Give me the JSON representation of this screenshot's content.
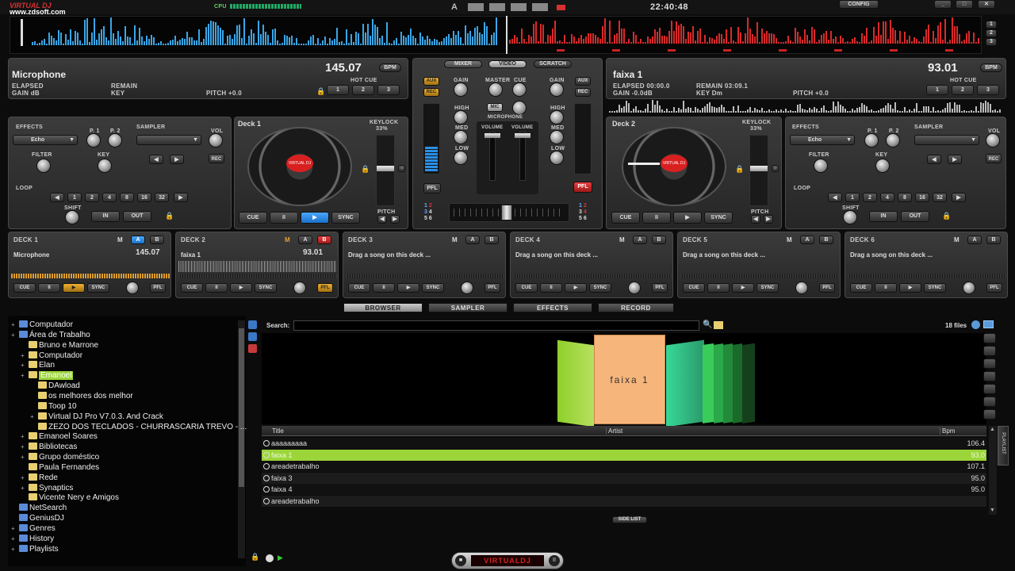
{
  "app": {
    "logo": "VIRTUAL DJ",
    "watermark": "www.zdsoft.com",
    "clock": "22:40:48",
    "cpu_label": "CPU",
    "config_label": "CONFIG",
    "layout_buttons": [
      "1",
      "2",
      "3"
    ],
    "a_label": "A"
  },
  "deckA": {
    "title": "Microphone",
    "bpm": "145.07",
    "bpm_unit": "BPM",
    "elapsed": "ELAPSED",
    "remain": "REMAIN",
    "gain": "GAIN dB",
    "key": "KEY",
    "pitch": "PITCH +0.0",
    "hotcue": "HOT CUE",
    "hotcues": [
      "1",
      "2",
      "3"
    ],
    "effects": "EFFECTS",
    "effect_value": "Echo",
    "p1": "P. 1",
    "p2": "P. 2",
    "filter": "FILTER",
    "key2": "KEY",
    "sampler": "SAMPLER",
    "vol": "VOL",
    "rec": "REC",
    "loop": "LOOP",
    "loop_values": [
      "1",
      "2",
      "4",
      "8",
      "16",
      "32"
    ],
    "shift": "SHIFT",
    "in": "IN",
    "out": "OUT",
    "deck_label": "Deck 1",
    "keylock": "KEYLOCK",
    "keylock_pct": "33%",
    "pitch_lbl": "PITCH",
    "cue": "CUE",
    "pause": "II",
    "play": "▶",
    "sync": "SYNC",
    "platter_logo": "VIRTUAL DJ"
  },
  "deckB": {
    "title": "faixa 1",
    "bpm": "93.01",
    "bpm_unit": "BPM",
    "elapsed": "ELAPSED 00:00.0",
    "remain": "REMAIN 03:09.1",
    "gain": "GAIN -0.0dB",
    "key": "KEY Dm",
    "pitch": "PITCH +0.0",
    "hotcue": "HOT CUE",
    "hotcues": [
      "1",
      "2",
      "3"
    ],
    "effects": "EFFECTS",
    "effect_value": "Echo",
    "p1": "P. 1",
    "p2": "P. 2",
    "filter": "FILTER",
    "key2": "KEY",
    "sampler": "SAMPLER",
    "vol": "VOL",
    "rec": "REC",
    "loop": "LOOP",
    "loop_values": [
      "1",
      "2",
      "4",
      "8",
      "16",
      "32"
    ],
    "shift": "SHIFT",
    "in": "IN",
    "out": "OUT",
    "deck_label": "Deck 2",
    "keylock": "KEYLOCK",
    "keylock_pct": "33%",
    "pitch_lbl": "PITCH",
    "cue": "CUE",
    "pause": "II",
    "play": "▶",
    "sync": "SYNC",
    "platter_logo": "VIRTUAL DJ"
  },
  "mixer": {
    "tabs": [
      "MIXER",
      "VIDEO",
      "SCRATCH"
    ],
    "aux": "AUX",
    "rec": "REC",
    "gain": "GAIN",
    "master": "MASTER",
    "cue": "CUE",
    "high": "HIGH",
    "med": "MED",
    "low": "LOW",
    "mic": "MIC",
    "microphone": "MICROPHONE",
    "volume": "VOLUME",
    "pfl": "PFL",
    "nums": [
      "1",
      "2",
      "3",
      "4",
      "5",
      "6"
    ]
  },
  "minidecks": [
    {
      "name": "DECK 1",
      "m": "M",
      "a": "A",
      "b": "B",
      "title": "Microphone",
      "bpm": "145.07"
    },
    {
      "name": "DECK 2",
      "m": "M",
      "a": "A",
      "b": "B",
      "title": "faixa 1",
      "bpm": "93.01"
    },
    {
      "name": "DECK 3",
      "m": "M",
      "a": "A",
      "b": "B",
      "title": "Drag a song on this deck ...",
      "bpm": ""
    },
    {
      "name": "DECK 4",
      "m": "M",
      "a": "A",
      "b": "B",
      "title": "Drag a song on this deck ...",
      "bpm": ""
    },
    {
      "name": "DECK 5",
      "m": "M",
      "a": "A",
      "b": "B",
      "title": "Drag a song on this deck ...",
      "bpm": ""
    },
    {
      "name": "DECK 6",
      "m": "M",
      "a": "A",
      "b": "B",
      "title": "Drag a song on this deck ...",
      "bpm": ""
    }
  ],
  "minideck_controls": {
    "cue": "CUE",
    "pause": "II",
    "play": "▶",
    "sync": "SYNC",
    "pfl": "PFL"
  },
  "tabs": [
    "BROWSER",
    "SAMPLER",
    "EFFECTS",
    "RECORD"
  ],
  "tree": [
    "Computador",
    "Área de Trabalho",
    "Bruno e Marrone",
    "Computador",
    "Elan",
    "Emanoel",
    "DAwload",
    "os melhores dos melhor",
    "Toop 10",
    "Virtual DJ Pro V7.0.3. And Crack",
    "ZEZO DOS TECLADOS  - CHURRASCARIA TREVO - ...",
    "Emanoel Soares",
    "Bibliotecas",
    "Grupo doméstico",
    "Paula Fernandes",
    "Rede",
    "Synaptics",
    "Vicente Nery e Amigos",
    "NetSearch",
    "GeniusDJ",
    "Genres",
    "History",
    "Playlists"
  ],
  "search": {
    "label": "Search:",
    "value": "",
    "count": "18 files"
  },
  "coverflow": {
    "center": "faixa 1"
  },
  "table": {
    "headers": [
      "Title",
      "Artist",
      "Bpm"
    ],
    "rows": [
      [
        "aaaaaaaaa",
        "",
        "106.4"
      ],
      [
        "faixa 1",
        "",
        "93.0"
      ],
      [
        "areadetrabalho",
        "",
        "107.1"
      ],
      [
        "faixa 3",
        "",
        "95.0"
      ],
      [
        "faixa 4",
        "",
        "95.0"
      ],
      [
        "areadetrabalho",
        "",
        ""
      ]
    ]
  },
  "side_list": "SIDE LIST",
  "playlist_tab": "PLAYLIST",
  "bottom_player": "VIRTUALDJ",
  "colors": {
    "accent_blue": "#2a8fe6",
    "wave_blue": "#3aa6e8",
    "wave_red": "#d82a2a",
    "row_select": "#9cd53a",
    "rec_red": "#d83030"
  }
}
